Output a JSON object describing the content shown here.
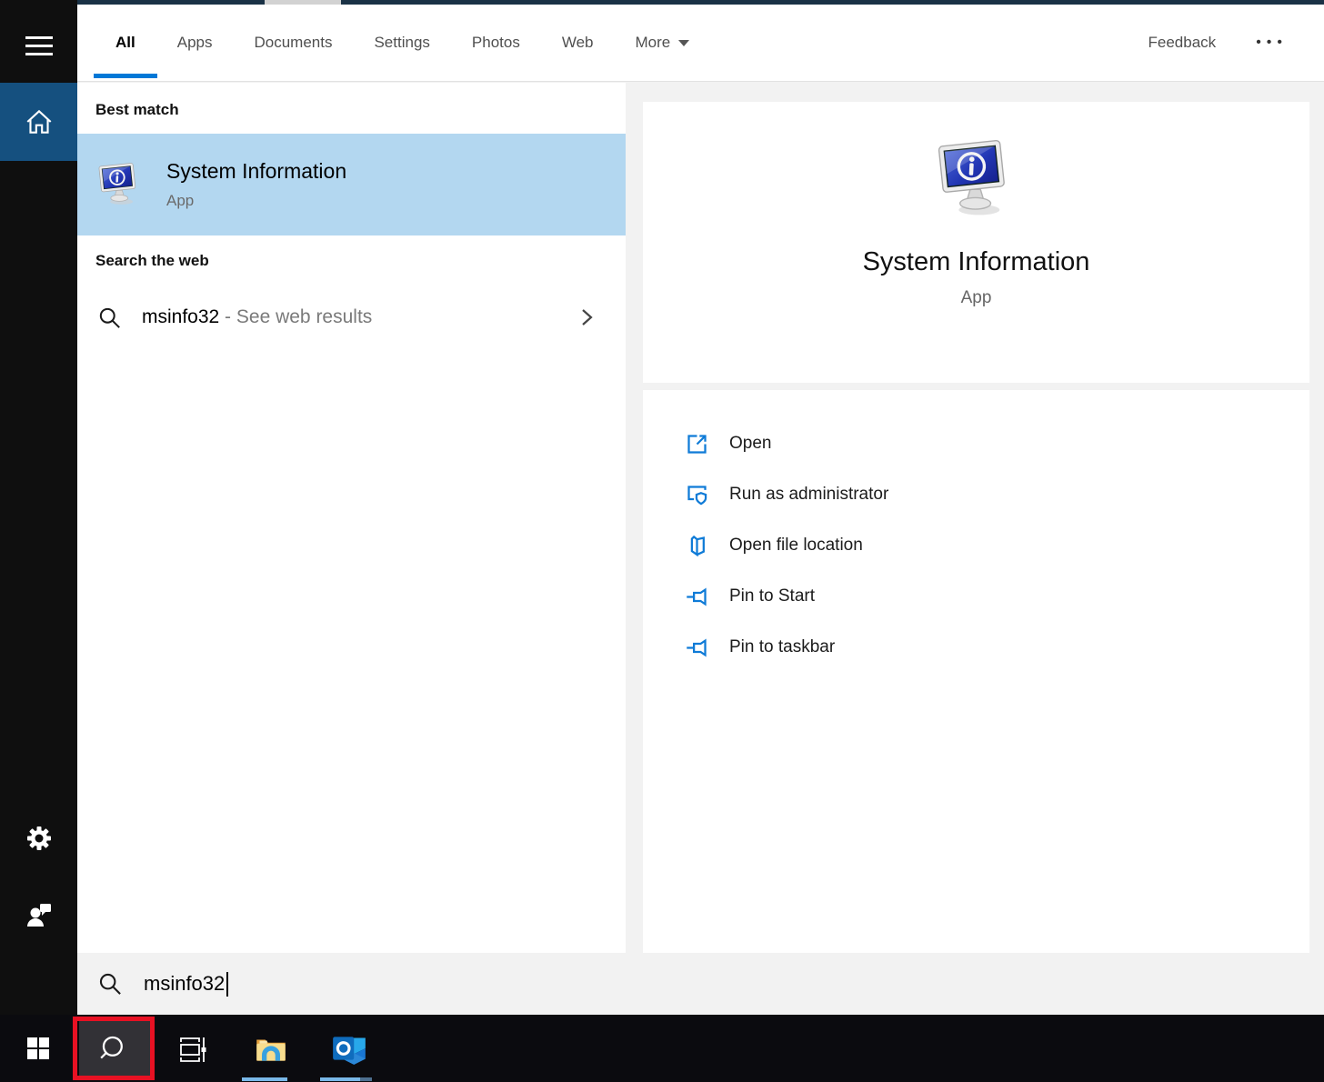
{
  "header": {
    "tabs": [
      {
        "label": "All"
      },
      {
        "label": "Apps"
      },
      {
        "label": "Documents"
      },
      {
        "label": "Settings"
      },
      {
        "label": "Photos"
      },
      {
        "label": "Web"
      },
      {
        "label": "More"
      }
    ],
    "active_tab": "All",
    "feedback_label": "Feedback",
    "ellipsis": "•••"
  },
  "results": {
    "best_match_heading": "Best match",
    "best_match": {
      "title": "System Information",
      "subtitle": "App"
    },
    "web_heading": "Search the web",
    "web_row": {
      "query": "msinfo32",
      "suffix": " - See web results"
    }
  },
  "preview": {
    "title": "System Information",
    "subtitle": "App",
    "actions": [
      "Open",
      "Run as administrator",
      "Open file location",
      "Pin to Start",
      "Pin to taskbar"
    ]
  },
  "searchbar": {
    "value": "msinfo32"
  },
  "taskbar": {
    "icons": [
      "start",
      "search",
      "task-view",
      "file-explorer",
      "outlook"
    ],
    "search_highlighted": true
  },
  "colors": {
    "accent": "#0078d7",
    "highlight_row": "#b3d7f0",
    "rail_active": "#15507f",
    "action_icon": "#0f7bd7",
    "annotation": "#e81123",
    "taskbar_bg": "#0b0b0f",
    "top_strip": "#1a3246"
  }
}
